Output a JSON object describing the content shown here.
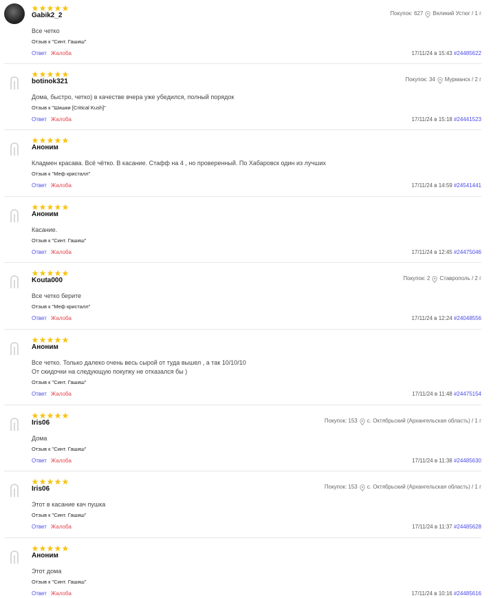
{
  "labels": {
    "reply": "Ответ",
    "complain": "Жалоба",
    "purchases_prefix": "Покупок:"
  },
  "colors": {
    "star": "#f5c518",
    "link_blue": "#4a4ae8",
    "link_red": "#e8404a",
    "divider": "#e6e6e6"
  },
  "reviews": [
    {
      "avatar": "user-photo",
      "rating": 5,
      "name": "Gabik2_2",
      "purchases": "627",
      "location": "Великий Устюг / 1 г",
      "text": "Все четко",
      "product": "Отзыв к \"Синт. Гашиш\"",
      "datetime": "17/11/24 в 15:43",
      "order": "#24485622"
    },
    {
      "avatar": "placeholder-icon",
      "rating": 5,
      "name": "botinok321",
      "purchases": "34",
      "location": "Мурманск / 2 г",
      "text": "Дома, быстро, четко) в качестве вчера уже убедился, полный порядок",
      "product": "Отзыв к \"Шишки [Critical Kush]\"",
      "datetime": "17/11/24 в 15:18",
      "order": "#24441523"
    },
    {
      "avatar": "placeholder-icon",
      "rating": 5,
      "name": "Аноним",
      "text": "Кладмен красава. Всё чётко. В касание. Стафф на 4 , но проверенный. По Хабаровск один из лучших",
      "product": "Отзыв к \"Меф кристалл\"",
      "datetime": "17/11/24 в 14:59",
      "order": "#24541441"
    },
    {
      "avatar": "placeholder-icon",
      "rating": 5,
      "name": "Аноним",
      "text": "Касание.",
      "product": "Отзыв к \"Синт. Гашиш\"",
      "datetime": "17/11/24 в 12:45",
      "order": "#24475046"
    },
    {
      "avatar": "placeholder-icon",
      "rating": 5,
      "name": "Kouta000",
      "purchases": "2",
      "location": "Ставрополь / 2 г",
      "text": "Все четко берите",
      "product": "Отзыв к \"Меф кристалл\"",
      "datetime": "17/11/24 в 12:24",
      "order": "#24048556"
    },
    {
      "avatar": "placeholder-icon",
      "rating": 5,
      "name": "Аноним",
      "text": "Все четко. Только далеко очень весь сырой от туда вышел , а так 10/10/10\nОт скидочки на следующую покупку не отказался бы )",
      "product": "Отзыв к \"Синт. Гашиш\"",
      "datetime": "17/11/24 в 11:48",
      "order": "#24475154"
    },
    {
      "avatar": "placeholder-icon",
      "rating": 5,
      "name": "Iris06",
      "purchases": "153",
      "location": "с. Октябрьский (Архангельская область) / 1 г",
      "text": "Дома",
      "product": "Отзыв к \"Синт. Гашиш\"",
      "datetime": "17/11/24 в 11:38",
      "order": "#24485630"
    },
    {
      "avatar": "placeholder-icon",
      "rating": 5,
      "name": "Iris06",
      "purchases": "153",
      "location": "с. Октябрьский (Архангельская область) / 1 г",
      "text": "Этот в касание кач пушка",
      "product": "Отзыв к \"Синт. Гашиш\"",
      "datetime": "17/11/24 в 11:37",
      "order": "#24485628"
    },
    {
      "avatar": "placeholder-icon",
      "rating": 5,
      "name": "Аноним",
      "text": "Этот дома",
      "product": "Отзыв к \"Синт. Гашиш\"",
      "datetime": "17/11/24 в 10:16",
      "order": "#24485616"
    }
  ]
}
